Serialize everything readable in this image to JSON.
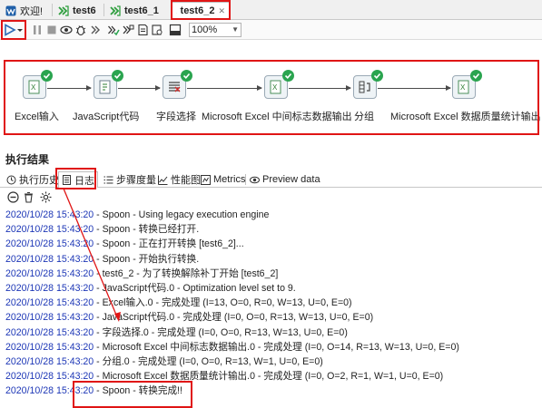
{
  "tabs": [
    {
      "label": "欢迎!",
      "icon": "welcome-icon",
      "active": false
    },
    {
      "label": "test6",
      "icon": "transformation-icon",
      "active": false
    },
    {
      "label": "test6_1",
      "icon": "transformation-icon",
      "active": false
    },
    {
      "label": "test6_2",
      "icon": "transformation-icon",
      "active": true,
      "close": "✕"
    }
  ],
  "toolbar": {
    "zoom_value": "100%",
    "icons": [
      "run-icon",
      "run-dropdown-icon",
      "pause-icon",
      "stop-icon",
      "preview-icon",
      "debug-icon",
      "replay-icon",
      "verify-icon",
      "impact-icon",
      "sql-icon",
      "explore-db-icon",
      "show-results-icon"
    ]
  },
  "canvas": {
    "steps": [
      {
        "label": "Excel输入",
        "icon": "excel-input-icon"
      },
      {
        "label": "JavaScript代码",
        "icon": "javascript-icon"
      },
      {
        "label": "字段选择",
        "icon": "select-values-icon"
      },
      {
        "label": "Microsoft Excel 中间标志数据输出",
        "icon": "excel-output-icon"
      },
      {
        "label": "分组",
        "icon": "group-by-icon"
      },
      {
        "label": "Microsoft Excel 数据质量统计输出",
        "icon": "excel-output-icon"
      }
    ]
  },
  "results": {
    "title": "执行结果",
    "tabs": [
      {
        "label": "执行历史",
        "icon": "history-icon"
      },
      {
        "label": "日志",
        "icon": "log-icon",
        "active": true
      },
      {
        "label": "步骤度量",
        "icon": "step-metrics-icon"
      },
      {
        "label": "性能图",
        "icon": "performance-icon"
      },
      {
        "label": "Metrics",
        "icon": "metrics-icon"
      },
      {
        "label": "Preview data",
        "icon": "preview-data-icon"
      }
    ],
    "log_tools": [
      "stop-log-icon",
      "clear-log-icon",
      "log-settings-icon"
    ],
    "log": [
      {
        "ts": "2020/10/28 15:43:20",
        "msg": " - Spoon - Using legacy execution engine"
      },
      {
        "ts": "2020/10/28 15:43:20",
        "msg": " - Spoon - 转换已经打开."
      },
      {
        "ts": "2020/10/28 15:43:20",
        "msg": " - Spoon - 正在打开转换 [test6_2]..."
      },
      {
        "ts": "2020/10/28 15:43:20",
        "msg": " - Spoon - 开始执行转换."
      },
      {
        "ts": "2020/10/28 15:43:20",
        "msg": " - test6_2 - 为了转换解除补丁开始  [test6_2]"
      },
      {
        "ts": "2020/10/28 15:43:20",
        "msg": " - JavaScript代码.0 - Optimization level set to 9."
      },
      {
        "ts": "2020/10/28 15:43:20",
        "msg": " - Excel输入.0 - 完成处理 (I=13, O=0, R=0, W=13, U=0, E=0)"
      },
      {
        "ts": "2020/10/28 15:43:20",
        "msg": " - JavaScript代码.0 - 完成处理 (I=0, O=0, R=13, W=13, U=0, E=0)"
      },
      {
        "ts": "2020/10/28 15:43:20",
        "msg": " - 字段选择.0 - 完成处理 (I=0, O=0, R=13, W=13, U=0, E=0)"
      },
      {
        "ts": "2020/10/28 15:43:20",
        "msg": " - Microsoft Excel 中间标志数据输出.0 - 完成处理 (I=0, O=14, R=13, W=13, U=0, E=0)"
      },
      {
        "ts": "2020/10/28 15:43:20",
        "msg": " - 分组.0 - 完成处理 (I=0, O=0, R=13, W=1, U=0, E=0)"
      },
      {
        "ts": "2020/10/28 15:43:20",
        "msg": " - Microsoft Excel 数据质量统计输出.0 - 完成处理 (I=0, O=2, R=1, W=1, U=0, E=0)"
      },
      {
        "ts": "2020/10/28 15:43:20",
        "msg": " - Spoon - 转换完成!!"
      }
    ]
  },
  "colors": {
    "annotation": "#e01515",
    "timestamp": "#1c36b6",
    "success": "#2aa44f"
  }
}
